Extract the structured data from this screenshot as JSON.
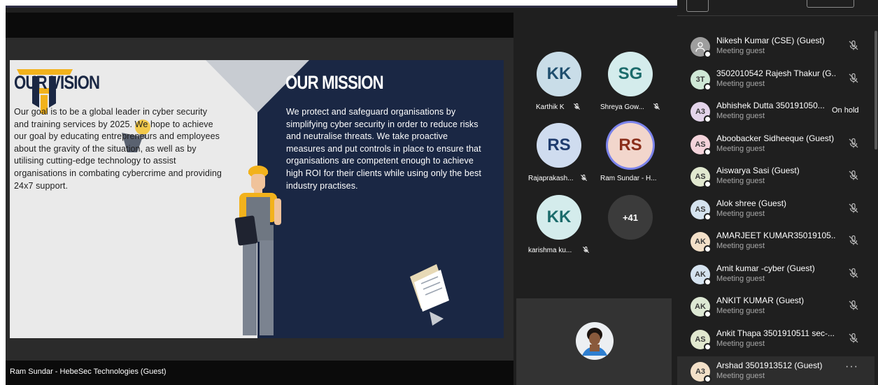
{
  "presenter": {
    "name": "Ram Sundar - HebeSec Technologies (Guest)"
  },
  "slide": {
    "vision_title": "OUR VISION",
    "vision_text": "Our goal is to be a global leader in cyber security and training services by 2025. We hope to achieve our goal by educating entrepreneurs and employees about the gravity of the situation, as well as by utilising cutting-edge technology to assist organisations in combating cybercrime and providing 24x7 support.",
    "mission_title": "OUR MISSION",
    "mission_text": "We protect and safeguard organisations by simplifying cyber security in order to reduce risks and neutralise threats. We take proactive measures and put controls in place to ensure that organisations are competent enough to achieve high ROI for their clients while using only the best industry practises.",
    "colors": {
      "navy": "#1a2744",
      "gold": "#f2b21c",
      "light": "#eaeaea"
    }
  },
  "tiles": [
    {
      "initials": "KK",
      "name": "Karthik K",
      "muted": true,
      "color": "#c9dde8",
      "text_color": "#1f4e6e"
    },
    {
      "initials": "SG",
      "name": "Shreya Gow...",
      "muted": true,
      "color": "#d4ecec",
      "text_color": "#1b6b6b"
    },
    {
      "initials": "RS",
      "name": "Rajaprakash...",
      "muted": true,
      "color": "#cfdcef",
      "text_color": "#1f3c6e"
    },
    {
      "initials": "RS",
      "name": "Ram Sundar - H...",
      "muted": false,
      "speaking": true,
      "color": "#f2d6cc",
      "text_color": "#8a2e1a"
    },
    {
      "initials": "KK",
      "name": "karishma ku...",
      "muted": true,
      "color": "#d4ecec",
      "text_color": "#1b6b6b"
    },
    {
      "initials": "+41",
      "name": "",
      "overflow": true,
      "color": "#3b3b3b",
      "text_color": "#ffffff"
    }
  ],
  "participants": [
    {
      "initials": "",
      "icon": "person-icon",
      "name": "Nikesh Kumar (CSE) (Guest)",
      "sub": "Meeting guest",
      "status": "muted",
      "color": "#9e9e9e"
    },
    {
      "initials": "3T",
      "name": "3502010542 Rajesh Thakur (G...",
      "sub": "Meeting guest",
      "status": "muted",
      "color": "#cfe8d6"
    },
    {
      "initials": "A3",
      "name": "Abhishek Dutta 350191050...",
      "sub": "Meeting guest",
      "status": "hold",
      "hold_text": "On hold",
      "color": "#e3d4ea"
    },
    {
      "initials": "AS",
      "name": "Aboobacker Sidheeque (Guest)",
      "sub": "Meeting guest",
      "status": "muted",
      "color": "#f3d3da"
    },
    {
      "initials": "AS",
      "name": "Aiswarya Sasi (Guest)",
      "sub": "Meeting guest",
      "status": "muted",
      "color": "#e1e8cf"
    },
    {
      "initials": "AS",
      "name": "Alok shree (Guest)",
      "sub": "Meeting guest",
      "status": "muted",
      "color": "#d5e3ef"
    },
    {
      "initials": "AK",
      "name": "AMARJEET KUMAR35019105...",
      "sub": "Meeting guest",
      "status": "muted",
      "color": "#f3e0c8"
    },
    {
      "initials": "AK",
      "name": "Amit kumar -cyber (Guest)",
      "sub": "Meeting guest",
      "status": "muted",
      "color": "#d5e3ef"
    },
    {
      "initials": "AK",
      "name": "ANKIT KUMAR (Guest)",
      "sub": "Meeting guest",
      "status": "muted",
      "color": "#dde8d4"
    },
    {
      "initials": "AS",
      "name": "Ankit Thapa 3501910511 sec-...",
      "sub": "Meeting guest",
      "status": "muted",
      "color": "#e1e8cf"
    },
    {
      "initials": "A3",
      "name": "Arshad 3501913512 (Guest)",
      "sub": "Meeting guest",
      "status": "more",
      "more_text": "···",
      "color": "#f3e0c8"
    }
  ]
}
